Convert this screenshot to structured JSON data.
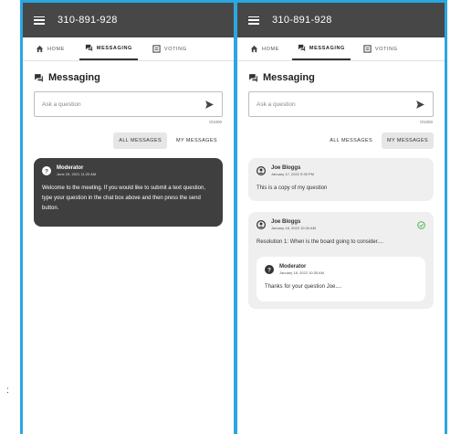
{
  "phone_number": "310-891-928",
  "tabs": {
    "home": "HOME",
    "messaging": "MESSAGING",
    "voting": "VOTING"
  },
  "section_title": "Messaging",
  "ask_placeholder": "Ask a question",
  "left": {
    "counter": "0/1000",
    "filters": {
      "all": "ALL MESSAGES",
      "mine": "MY MESSAGES"
    },
    "moderator_card": {
      "author": "Moderator",
      "time": "June 29, 2021 11:20 AM",
      "text": "Welcome to the meeting. If you would like to submit a text question, type your question in the chat box above and then press the send button."
    }
  },
  "right": {
    "counter": "0/1000",
    "filters": {
      "all": "ALL MESSAGES",
      "mine": "MY MESSAGES"
    },
    "messages": [
      {
        "author": "Joe Bloggs",
        "time": "January 17, 2022 9:35 PM",
        "text": "This is a copy of my question"
      },
      {
        "author": "Joe Bloggs",
        "time": "January 18, 2022 10:34 AM",
        "text": "Resolution 1: When is the board going to consider....",
        "reply": {
          "author": "Moderator",
          "time": "January 18, 2022 10:35 AM",
          "text": "Thanks for your question Joe...."
        }
      }
    ]
  },
  "colors": {
    "frame": "#2aa7e0",
    "topbar": "#474747",
    "dark_card": "#3f3f3f",
    "light_card": "#efefef",
    "answered_check": "#4caf50"
  }
}
